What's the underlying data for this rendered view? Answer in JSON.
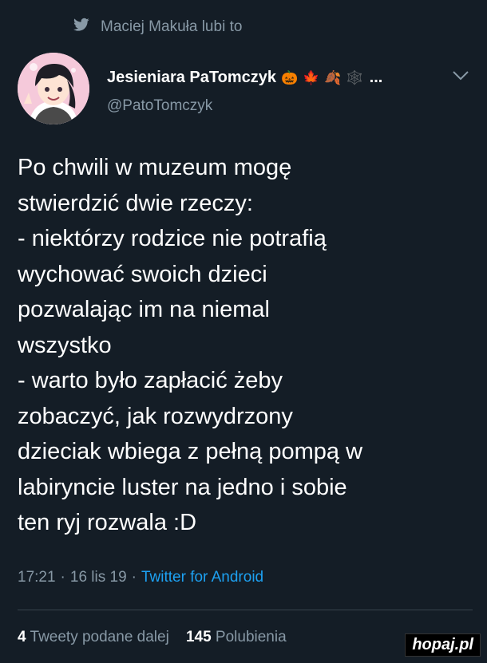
{
  "liked_by": {
    "icon": "twitter-bird-icon",
    "text": "Maciej Makuła lubi to"
  },
  "author": {
    "display_name": "Jesienia­ra PaTomczyk",
    "emojis": [
      "🎃",
      "🍁",
      "🍂",
      "🕸️"
    ],
    "ellipsis": "...",
    "handle": "@PatoTomczyk"
  },
  "tweet": {
    "text": "Po chwili w muzeum mogę\nstwierdzić dwie rzeczy:\n- niektórzy rodzice nie potrafią\nwychować swoich dzieci\npozwalając im na niemal\nwszystko\n- warto było zapłacić żeby\nzobaczyć, jak rozwydrzony\ndzieciak wbiega z pełną pompą w\nlabiryncie luster na jedno i sobie\nten ryj rozwala :D",
    "time": "17:21",
    "date": "16 lis 19",
    "separator": "·",
    "client": "Twitter for Android"
  },
  "stats": {
    "retweets_count": "4",
    "retweets_label": "Tweety podane dalej",
    "likes_count": "145",
    "likes_label": "Polubienia"
  },
  "watermark": "hopaj.pl",
  "colors": {
    "background": "#141d26",
    "secondary_text": "#8899a6",
    "link": "#1da1f2"
  }
}
